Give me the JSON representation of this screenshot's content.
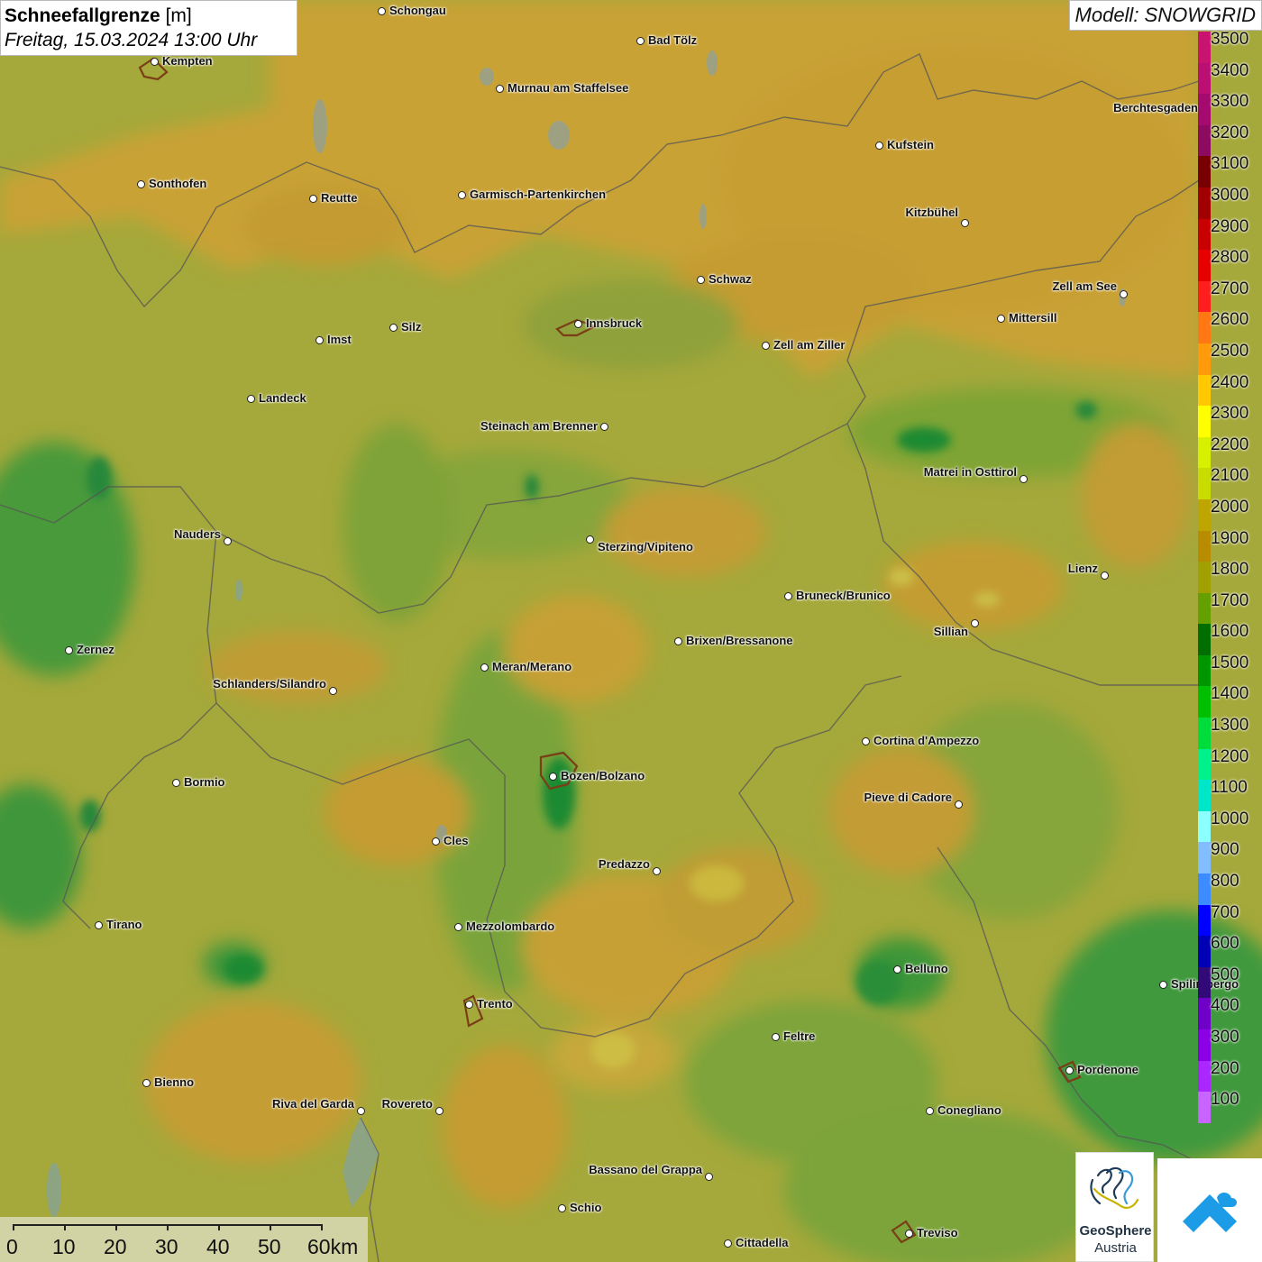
{
  "title": {
    "parameter": "Schneefallgrenze",
    "unit": "[m]",
    "datetime": "Freitag, 15.03.2024 13:00 Uhr"
  },
  "model": "Modell: SNOWGRID",
  "legend": [
    {
      "value": "3500",
      "color": "#c8146e"
    },
    {
      "value": "3400",
      "color": "#bc0f73"
    },
    {
      "value": "3300",
      "color": "#a50a6e"
    },
    {
      "value": "3200",
      "color": "#8c0a5f"
    },
    {
      "value": "3100",
      "color": "#780000"
    },
    {
      "value": "3000",
      "color": "#a00000"
    },
    {
      "value": "2900",
      "color": "#c80000"
    },
    {
      "value": "2800",
      "color": "#e60000"
    },
    {
      "value": "2700",
      "color": "#ff1e1e"
    },
    {
      "value": "2600",
      "color": "#ff7814"
    },
    {
      "value": "2500",
      "color": "#ff9b0a"
    },
    {
      "value": "2400",
      "color": "#ffc800"
    },
    {
      "value": "2300",
      "color": "#ffff00"
    },
    {
      "value": "2200",
      "color": "#d7f000"
    },
    {
      "value": "2100",
      "color": "#c8dc00"
    },
    {
      "value": "2000",
      "color": "#bea500"
    },
    {
      "value": "1900",
      "color": "#b98c00"
    },
    {
      "value": "1800",
      "color": "#a0a000"
    },
    {
      "value": "1700",
      "color": "#64a000"
    },
    {
      "value": "1600",
      "color": "#006e00"
    },
    {
      "value": "1500",
      "color": "#009600"
    },
    {
      "value": "1400",
      "color": "#00be00"
    },
    {
      "value": "1300",
      "color": "#00dc3c"
    },
    {
      "value": "1200",
      "color": "#00f08c"
    },
    {
      "value": "1100",
      "color": "#00e6c8"
    },
    {
      "value": "1000",
      "color": "#8cffff"
    },
    {
      "value": "900",
      "color": "#82beff"
    },
    {
      "value": "800",
      "color": "#3c8cff"
    },
    {
      "value": "700",
      "color": "#0000ff"
    },
    {
      "value": "600",
      "color": "#0000b4"
    },
    {
      "value": "500",
      "color": "#320a78"
    },
    {
      "value": "400",
      "color": "#6e00c8"
    },
    {
      "value": "300",
      "color": "#8c00e6"
    },
    {
      "value": "200",
      "color": "#aa28ff"
    },
    {
      "value": "100",
      "color": "#c864ff"
    }
  ],
  "cities": [
    {
      "name": "Schongau",
      "side": "r"
    },
    {
      "name": "Bad Tölz",
      "side": "r"
    },
    {
      "name": "Kempten",
      "side": "r"
    },
    {
      "name": "Murnau am Staffelsee",
      "side": "r"
    },
    {
      "name": "Berchtesgaden",
      "side": "l"
    },
    {
      "name": "Kufstein",
      "side": "r"
    },
    {
      "name": "Sonthofen",
      "side": "r"
    },
    {
      "name": "Reutte",
      "side": "r"
    },
    {
      "name": "Garmisch-Partenkirchen",
      "side": "r"
    },
    {
      "name": "Kitzbühel",
      "side": "l"
    },
    {
      "name": "Schwaz",
      "side": "r"
    },
    {
      "name": "Zell am See",
      "side": "l"
    },
    {
      "name": "Innsbruck",
      "side": "r"
    },
    {
      "name": "Mittersill",
      "side": "r"
    },
    {
      "name": "Silz",
      "side": "r"
    },
    {
      "name": "Imst",
      "side": "r"
    },
    {
      "name": "Zell am Ziller",
      "side": "r"
    },
    {
      "name": "Landeck",
      "side": "r"
    },
    {
      "name": "Steinach am Brenner",
      "side": "l"
    },
    {
      "name": "Matrei in Osttirol",
      "side": "l"
    },
    {
      "name": "Nauders",
      "side": "l"
    },
    {
      "name": "Sterzing/Vipiteno",
      "side": "r"
    },
    {
      "name": "Lienz",
      "side": "l"
    },
    {
      "name": "Bruneck/Brunico",
      "side": "r"
    },
    {
      "name": "Sillian",
      "side": "l"
    },
    {
      "name": "Zernez",
      "side": "r"
    },
    {
      "name": "Brixen/Bressanone",
      "side": "r"
    },
    {
      "name": "Meran/Merano",
      "side": "r"
    },
    {
      "name": "Schlanders/Silandro",
      "side": "l"
    },
    {
      "name": "Cortina d'Ampezzo",
      "side": "r"
    },
    {
      "name": "Bozen/Bolzano",
      "side": "r"
    },
    {
      "name": "Bormio",
      "side": "r"
    },
    {
      "name": "Pieve di Cadore",
      "side": "l"
    },
    {
      "name": "Cles",
      "side": "r"
    },
    {
      "name": "Predazzo",
      "side": "l"
    },
    {
      "name": "Tirano",
      "side": "r"
    },
    {
      "name": "Mezzolombardo",
      "side": "r"
    },
    {
      "name": "Belluno",
      "side": "r"
    },
    {
      "name": "Spilimbergo",
      "side": "r"
    },
    {
      "name": "Trento",
      "side": "r"
    },
    {
      "name": "Feltre",
      "side": "r"
    },
    {
      "name": "Pordenone",
      "side": "r"
    },
    {
      "name": "Bienno",
      "side": "r"
    },
    {
      "name": "Riva del Garda",
      "side": "l"
    },
    {
      "name": "Rovereto",
      "side": "l"
    },
    {
      "name": "Conegliano",
      "side": "r"
    },
    {
      "name": "Bassano del Grappa",
      "side": "l"
    },
    {
      "name": "Schio",
      "side": "r"
    },
    {
      "name": "Treviso",
      "side": "r"
    },
    {
      "name": "Cittadella",
      "side": "r"
    }
  ],
  "scale": {
    "ticks": [
      "0",
      "10",
      "20",
      "30",
      "40",
      "50",
      "60km"
    ]
  },
  "logos": {
    "geosphere_line1": "GeoSphere",
    "geosphere_line2": "Austria"
  }
}
